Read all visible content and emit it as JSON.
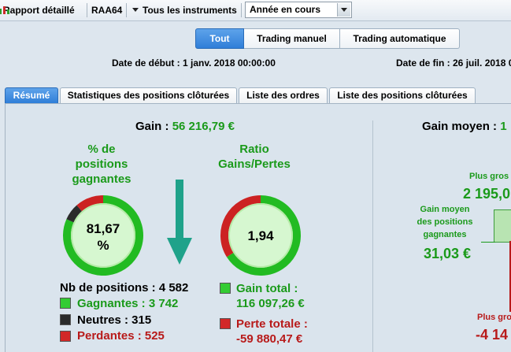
{
  "toolbar": {
    "report": "Rapport détaillé",
    "account": "RAA64",
    "instruments": "Tous les instruments",
    "period": "Année en cours"
  },
  "filter": {
    "all": "Tout",
    "manual": "Trading manuel",
    "auto": "Trading automatique"
  },
  "dates": {
    "start": "Date de début : 1 janv. 2018 00:00:00",
    "end": "Date de fin : 26 juil. 2018 0"
  },
  "tabs": [
    {
      "label": "Résumé"
    },
    {
      "label": "Statistiques des positions clôturées"
    },
    {
      "label": "Liste des ordres"
    },
    {
      "label": "Liste des positions clôturées"
    }
  ],
  "summary": {
    "gain_label": "Gain :",
    "gain_value": "56 216,79 €",
    "pct_title": [
      "% de",
      "positions",
      "gagnantes"
    ],
    "pct_value": "81,67",
    "pct_unit": "%",
    "ratio_title": [
      "Ratio",
      "Gains/Pertes"
    ],
    "ratio_value": "1,94",
    "positions_label": "Nb de positions : 4 582",
    "winning": "Gagnantes : 3 742",
    "neutral": "Neutres : 315",
    "losing": "Perdantes : 525",
    "total_gain_label": "Gain total :",
    "total_gain_value": "116 097,26 €",
    "total_loss_label": "Perte totale :",
    "total_loss_value": "-59 880,47 €"
  },
  "gauges": {
    "pct_winning": 0.8167,
    "pct_neutral": 0.0687,
    "pct_losing": 0.1146,
    "ratio_gain_share": 0.66,
    "ratio_loss_share": 0.34
  },
  "right": {
    "avg_gain_label": "Gain moyen :",
    "avg_gain_value": "1",
    "biggest_gain_label": "Plus gros",
    "biggest_gain_value": "2 195,0",
    "avg_winning_label": [
      "Gain moyen",
      "des positions",
      "gagnantes"
    ],
    "avg_winning_value": "31,03 €",
    "biggest_loss_label": "Plus gro",
    "biggest_loss_value": "-4 14"
  },
  "colors": {
    "win": "#22bb22",
    "loss": "#cc2222",
    "neutral": "#2b2b2b",
    "accent": "#2f7ed8",
    "arrow": "#1fa28a"
  }
}
